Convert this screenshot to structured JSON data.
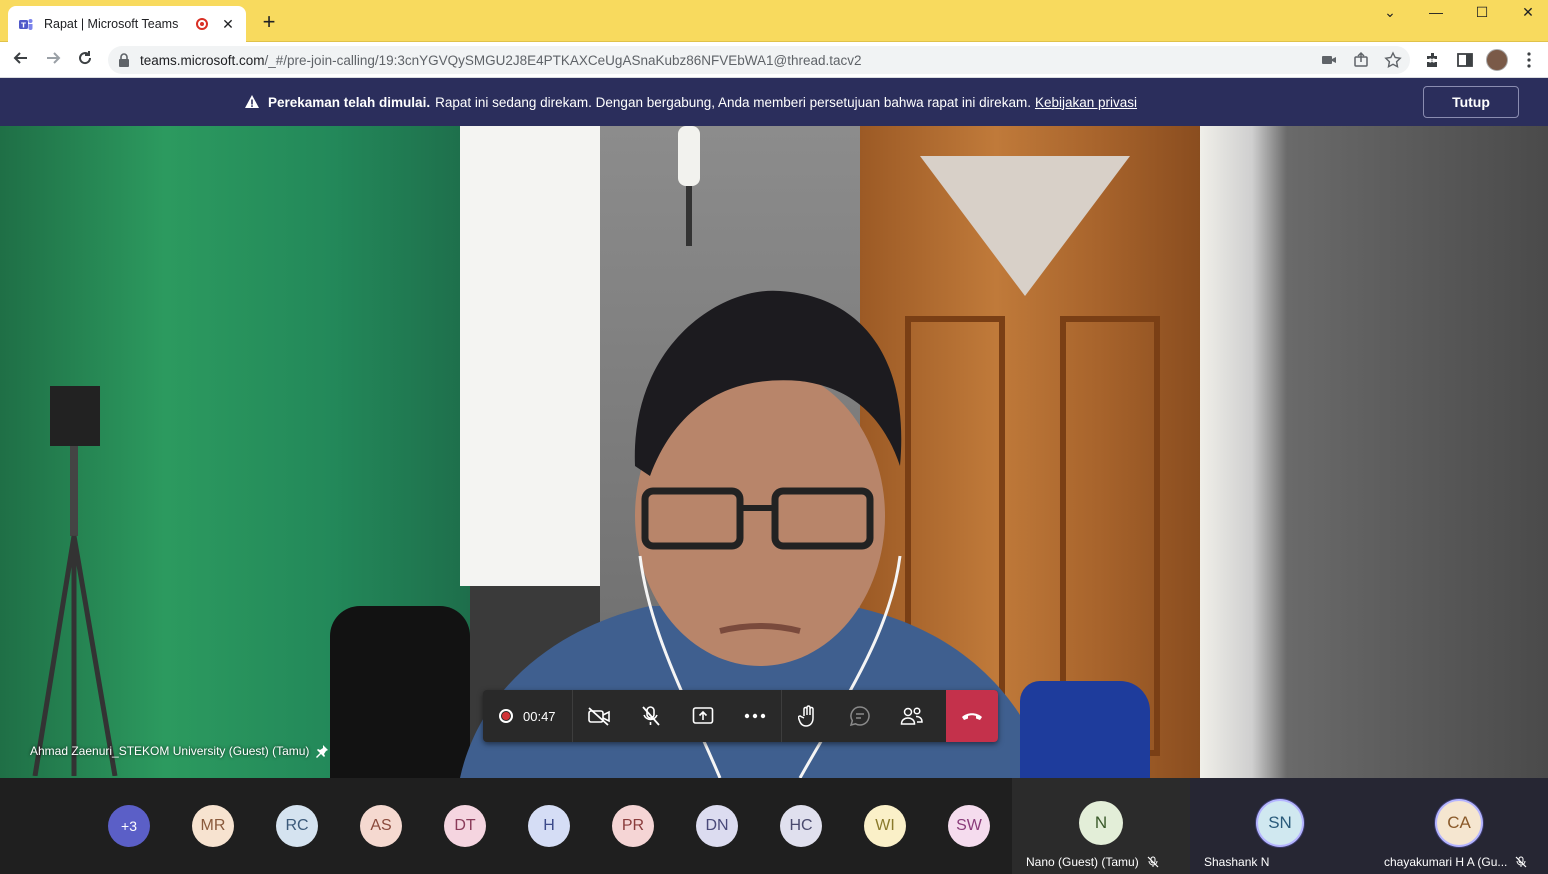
{
  "browser": {
    "tab_title": "Rapat | Microsoft Teams",
    "tab_close": "✕",
    "new_tab": "+",
    "url_host": "teams.microsoft.com",
    "url_path": "/_#/pre-join-calling/19:3cnYGVQySMGU2J8E4PTKAXCeUgASnaKubz86NFVEbWA1@thread.tacv2",
    "window_controls": [
      "⌄",
      "—",
      "☐",
      "✕"
    ]
  },
  "banner": {
    "title": "Perekaman telah dimulai.",
    "message": "Rapat ini sedang direkam. Dengan bergabung, Anda memberi persetujuan bahwa rapat ini direkam.",
    "link": "Kebijakan privasi",
    "close_label": "Tutup"
  },
  "stage": {
    "speaker_name": "Ahmad Zaenuri_STEKOM University (Guest) (Tamu)"
  },
  "controls": {
    "timer": "00:47",
    "buttons": [
      "camera-off-icon",
      "mic-off-icon",
      "share-icon",
      "more-icon",
      "raise-hand-icon",
      "chat-icon",
      "participants-icon",
      "hangup-icon"
    ]
  },
  "participants": {
    "overflow": "+3",
    "avatars": [
      {
        "initials": "MR",
        "bg": "#f7e3d0",
        "fg": "#8a5a3c"
      },
      {
        "initials": "RC",
        "bg": "#d5e3f0",
        "fg": "#3c5a7a"
      },
      {
        "initials": "AS",
        "bg": "#f5d9d0",
        "fg": "#8a4a3c"
      },
      {
        "initials": "DT",
        "bg": "#f5d5e0",
        "fg": "#8a3c5a"
      },
      {
        "initials": "H",
        "bg": "#d5ddf5",
        "fg": "#3c4a8a"
      },
      {
        "initials": "PR",
        "bg": "#f5d5d5",
        "fg": "#8a3c3c"
      },
      {
        "initials": "DN",
        "bg": "#dcdcf0",
        "fg": "#4a4a7a"
      },
      {
        "initials": "HC",
        "bg": "#e0e0ee",
        "fg": "#4a4a6e"
      },
      {
        "initials": "WI",
        "bg": "#faf0c8",
        "fg": "#8a7a2c"
      },
      {
        "initials": "SW",
        "bg": "#f5dcee",
        "fg": "#8a3c7a"
      }
    ],
    "tiles": [
      {
        "initials": "N",
        "name": "Nano (Guest) (Tamu)",
        "bg": "#e3eed8",
        "fg": "#3a5a2a"
      },
      {
        "initials": "SN",
        "name": "Shashank N",
        "bg": "#d0e8f0",
        "fg": "#2a5a7a"
      },
      {
        "initials": "CA",
        "name": "chayakumari H A (Gu...",
        "bg": "#f5e6d0",
        "fg": "#8a5a2a"
      }
    ]
  }
}
